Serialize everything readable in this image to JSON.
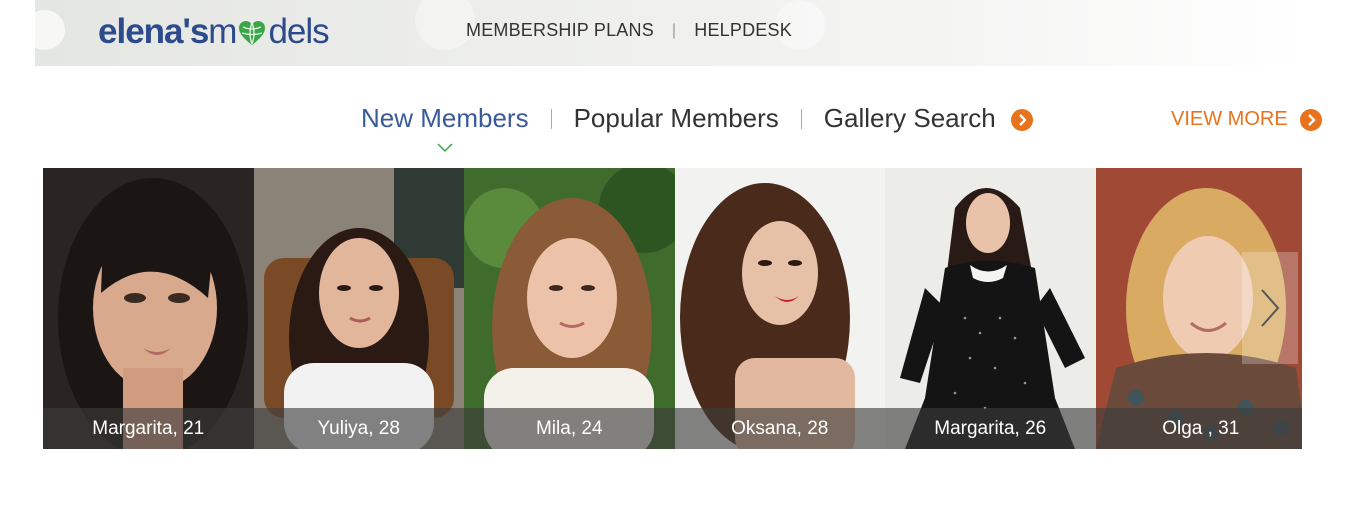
{
  "header": {
    "logo": {
      "part1": "elena's",
      "part2": "m",
      "part3": "dels"
    },
    "nav": [
      {
        "label": "MEMBERSHIP PLANS"
      },
      {
        "label": "HELPDESK"
      }
    ]
  },
  "tabs": [
    {
      "label": "New Members",
      "active": true
    },
    {
      "label": "Popular Members",
      "active": false
    },
    {
      "label": "Gallery Search",
      "active": false
    }
  ],
  "view_more": "VIEW MORE",
  "colors": {
    "accent": "#e8731c",
    "brand": "#2c4a8c",
    "heart_green": "#3aa648"
  },
  "members": [
    {
      "caption": "Margarita, 21"
    },
    {
      "caption": "Yuliya, 28"
    },
    {
      "caption": "Mila, 24"
    },
    {
      "caption": "Oksana, 28"
    },
    {
      "caption": "Margarita, 26"
    },
    {
      "caption": "Olga , 31"
    }
  ],
  "icons": {
    "next": "chevron-right-icon",
    "tab_indicator": "chevron-down-icon",
    "arrow": "orange-arrow-icon",
    "logo_heart": "heart-globe-icon"
  }
}
